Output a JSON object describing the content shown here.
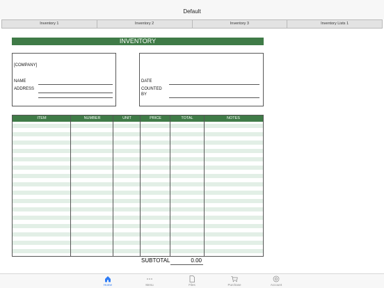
{
  "window": {
    "title": "Default"
  },
  "sheet_tabs": [
    "Inventory 1",
    "Inventory 2",
    "Inventory 3",
    "Inventory Lists 1"
  ],
  "document": {
    "banner": "INVENTORY",
    "company_placeholder": "[COMPANY]",
    "name_label": "NAME",
    "address_label": "ADDRESS",
    "date_label": "DATE",
    "counted_label_line1": "COUNTED",
    "counted_label_line2": "BY",
    "columns": [
      "ITEM",
      "NUMBER",
      "UNIT",
      "PRICE",
      "TOTAL",
      "NOTES"
    ],
    "subtotal_label": "SUBTOTAL",
    "subtotal_value": "0.00"
  },
  "tabbar": {
    "items": [
      {
        "label": "Home",
        "icon": "home-icon",
        "active": true
      },
      {
        "label": "Menu",
        "icon": "ellipsis-icon",
        "active": false
      },
      {
        "label": "Files",
        "icon": "file-icon",
        "active": false
      },
      {
        "label": "Purchase",
        "icon": "cart-icon",
        "active": false
      },
      {
        "label": "Account",
        "icon": "gear-icon",
        "active": false
      }
    ],
    "active_color": "#2e7cf6"
  },
  "colors": {
    "accent_green": "#3f7b47",
    "row_band": "#e2efe6"
  }
}
